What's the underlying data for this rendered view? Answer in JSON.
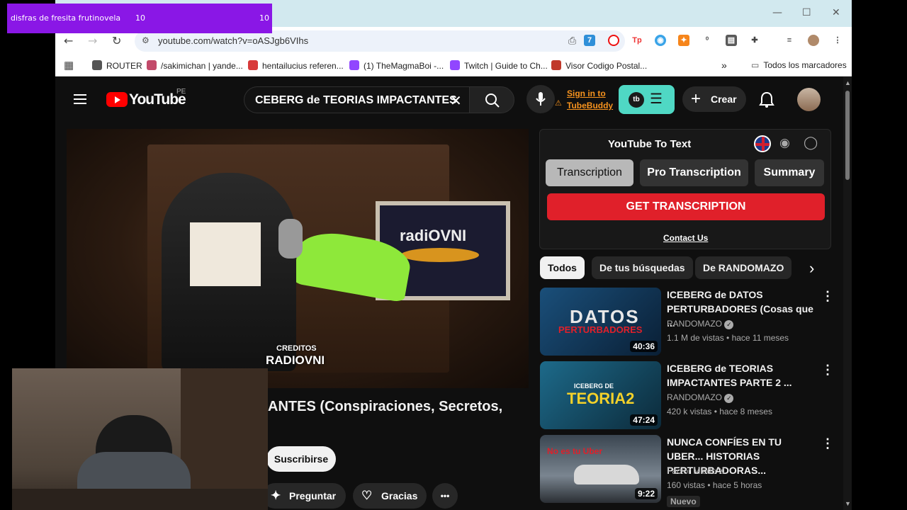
{
  "overlay": {
    "title": "disfras de fresita frutinovela",
    "count_a": "10",
    "count_b": "10"
  },
  "browser": {
    "url": "youtube.com/watch?v=oASJgb6VIhs",
    "bookmarks": [
      {
        "label": "ROUTER",
        "color": "#555555"
      },
      {
        "label": "/sakimichan | yande...",
        "color": "#c24a6a"
      },
      {
        "label": "hentailucius referen...",
        "color": "#d83a3a"
      },
      {
        "label": "(1) TheMagmaBoi -...",
        "color": "#9146ff"
      },
      {
        "label": "Twitch | Guide to Ch...",
        "color": "#9146ff"
      },
      {
        "label": "Visor Codigo Postal...",
        "color": "#c0392b"
      }
    ],
    "all_bookmarks": "Todos los marcadores"
  },
  "youtube": {
    "logo_text": "YouTube",
    "region": "PE",
    "search_value": "CEBERG de TEORIAS IMPACTANTES",
    "tubebuddy_line1": "Sign in to",
    "tubebuddy_line2": "TubeBuddy",
    "create_label": "Crear",
    "video": {
      "overlay_text1": "CREDITOS",
      "overlay_text2": "RADIOVNI",
      "screen_text": "radiOVNI",
      "title_partial": "ANTES (Conspiraciones, Secretos,",
      "subscribe_label": "Suscribirse",
      "ask_label": "Preguntar",
      "thanks_label": "Gracias",
      "more_label": "•••"
    },
    "extension": {
      "title": "YouTube To Text",
      "tabs": [
        "Transcription",
        "Pro Transcription",
        "Summary"
      ],
      "get_label": "GET TRANSCRIPTION",
      "contact_label": "Contact Us"
    },
    "chips": [
      "Todos",
      "De tus búsquedas",
      "De RANDOMAZO"
    ],
    "recommendations": [
      {
        "title": "ICEBERG de DATOS PERTURBADORES (Cosas que ...",
        "channel": "RANDOMAZO",
        "meta": "1.1 M de vistas • hace 11 meses",
        "duration": "40:36",
        "thumb_text": "DATOS",
        "thumb_sub": "PERTURBADORES",
        "verified": true
      },
      {
        "title": "ICEBERG de TEORIAS IMPACTANTES PARTE 2 ...",
        "channel": "RANDOMAZO",
        "meta": "420 k vistas • hace 8 meses",
        "duration": "47:24",
        "thumb_text": "TEORIA2",
        "thumb_sub": "ICEBERG DE",
        "verified": true
      },
      {
        "title": "NUNCA CONFÍES EN TU UBER... HISTORIAS PERTURBADORAS...",
        "channel": "Factor Miedo X",
        "meta": "160 vistas • hace 5 horas",
        "duration": "9:22",
        "thumb_text": "No es tu Uber",
        "thumb_sub": "",
        "badge": "Nuevo",
        "verified": false
      }
    ]
  },
  "colors": {
    "accent_red": "#ff0000",
    "tubebuddy_orange": "#f7931e",
    "overlay_purple": "#8a17e6",
    "tubebuddy_teal": "#4fd8c4"
  }
}
